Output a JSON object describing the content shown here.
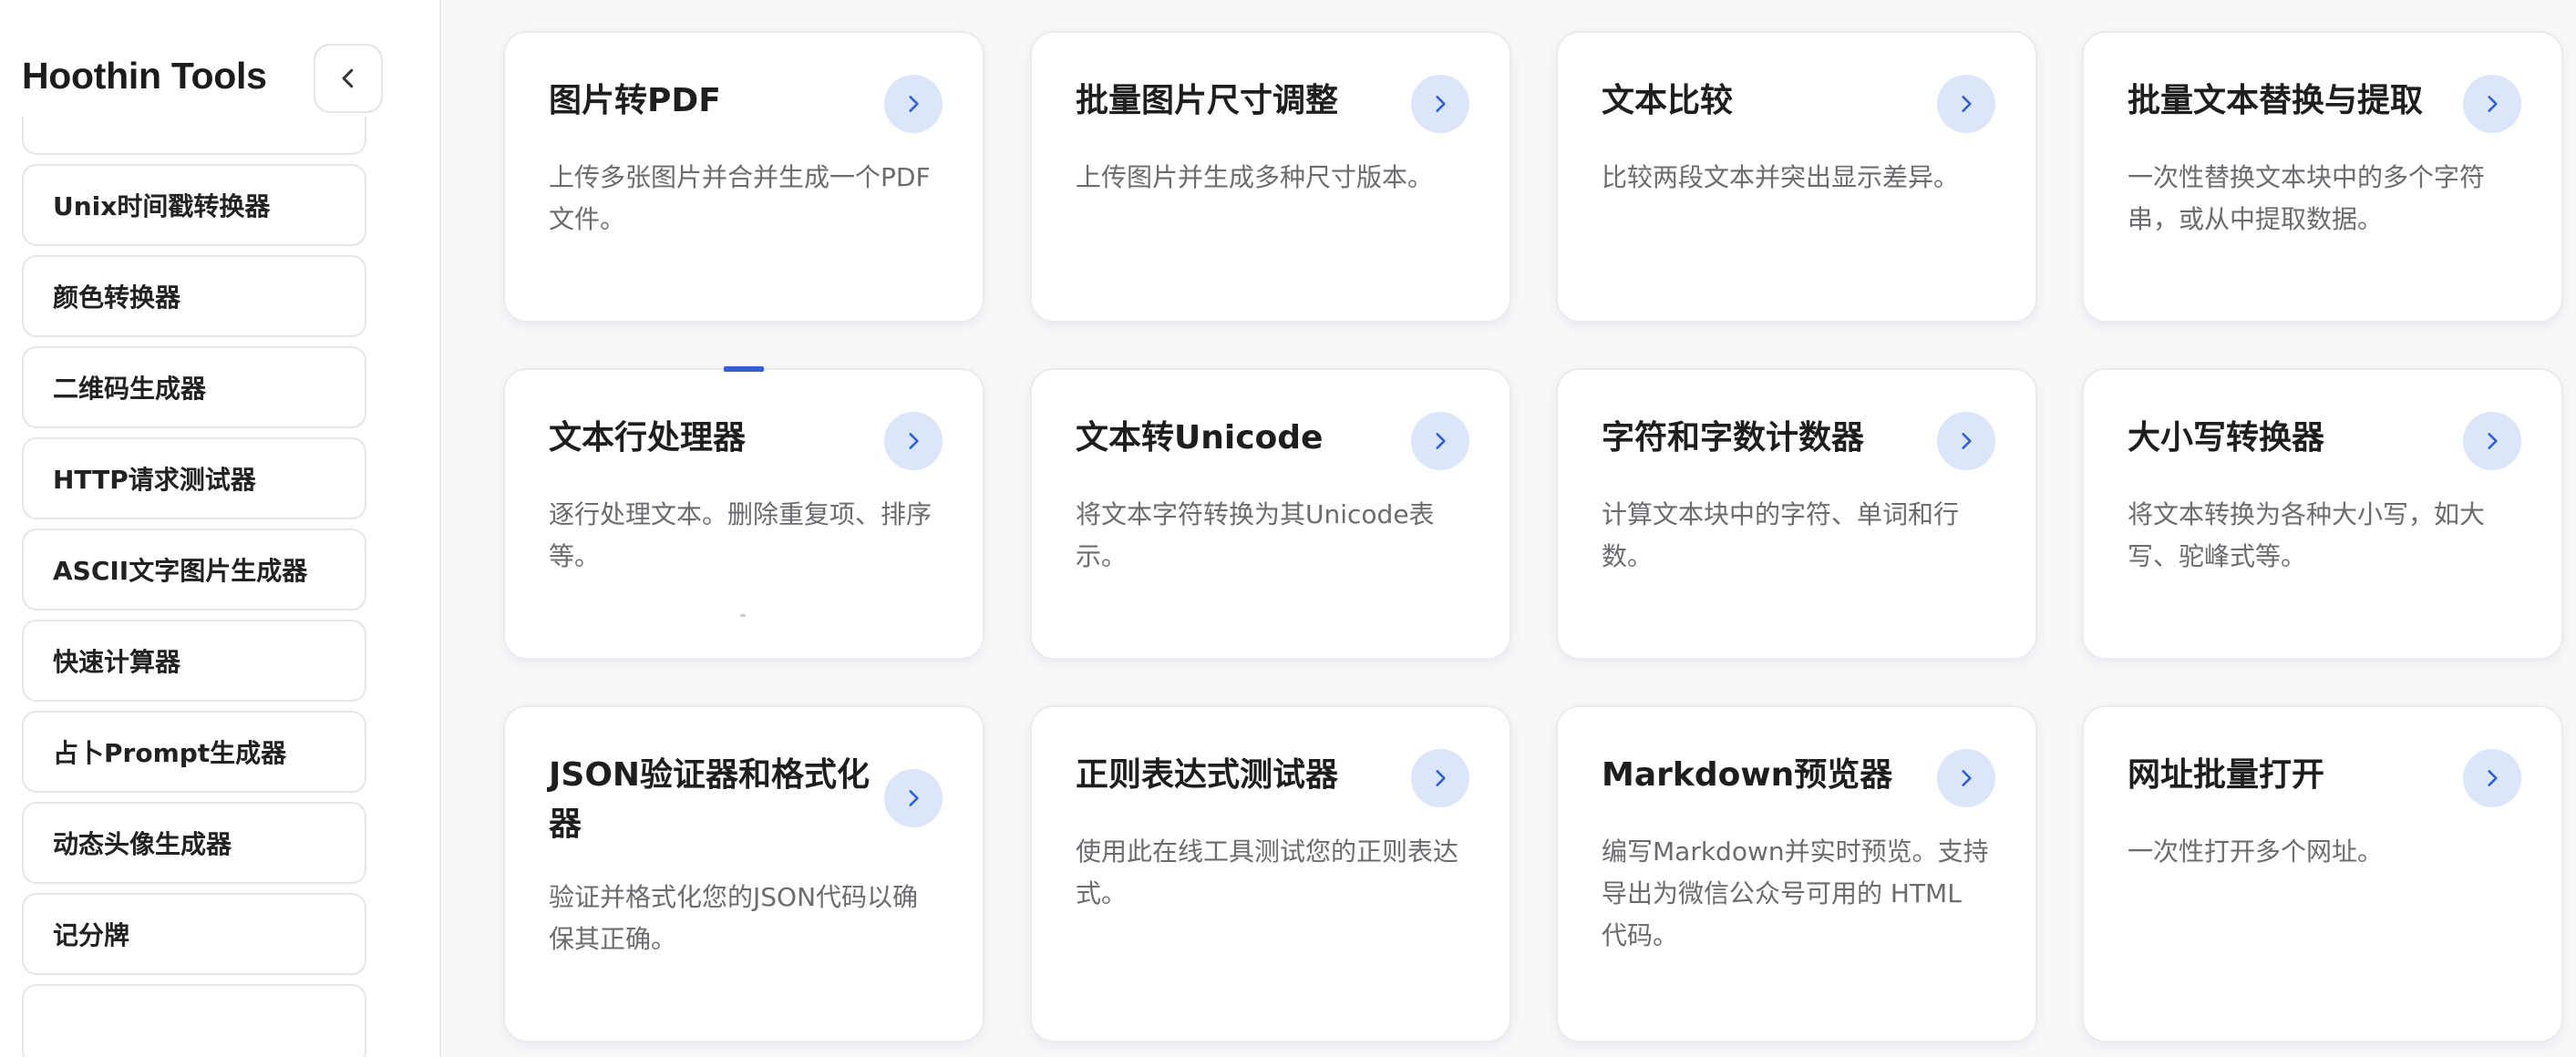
{
  "sidebar": {
    "brand": "Hoothin Tools",
    "items": [
      {
        "label": "Unix时间戳转换器"
      },
      {
        "label": "颜色转换器"
      },
      {
        "label": "二维码生成器"
      },
      {
        "label": "HTTP请求测试器"
      },
      {
        "label": "ASCII文字图片生成器"
      },
      {
        "label": "快速计算器"
      },
      {
        "label": "占卜Prompt生成器"
      },
      {
        "label": "动态头像生成器"
      },
      {
        "label": "记分牌"
      }
    ]
  },
  "tools": [
    {
      "title": "图片转PDF",
      "desc": "上传多张图片并合并生成一个PDF文件。"
    },
    {
      "title": "批量图片尺寸调整",
      "desc": "上传图片并生成多种尺寸版本。"
    },
    {
      "title": "文本比较",
      "desc": "比较两段文本并突出显示差异。"
    },
    {
      "title": "批量文本替换与提取",
      "desc": "一次性替换文本块中的多个字符串，或从中提取数据。"
    },
    {
      "title": "文本行处理器",
      "desc": "逐行处理文本。删除重复项、排序等。"
    },
    {
      "title": "文本转Unicode",
      "desc": "将文本字符转换为其Unicode表示。"
    },
    {
      "title": "字符和字数计数器",
      "desc": "计算文本块中的字符、单词和行数。"
    },
    {
      "title": "大小写转换器",
      "desc": "将文本转换为各种大小写，如大写、驼峰式等。"
    },
    {
      "title": "JSON验证器和格式化器",
      "desc": "验证并格式化您的JSON代码以确保其正确。"
    },
    {
      "title": "正则表达式测试器",
      "desc": "使用此在线工具测试您的正则表达式。"
    },
    {
      "title": "Markdown预览器",
      "desc": "编写Markdown并实时预览。支持导出为微信公众号可用的 HTML 代码。"
    },
    {
      "title": "网址批量打开",
      "desc": "一次性打开多个网址。"
    }
  ],
  "colors": {
    "accent": "#2f5fd9",
    "arrow_bg": "#dbe6fa"
  },
  "icons": {
    "collapse": "chevron-left-icon",
    "card_arrow": "chevron-right-icon"
  }
}
